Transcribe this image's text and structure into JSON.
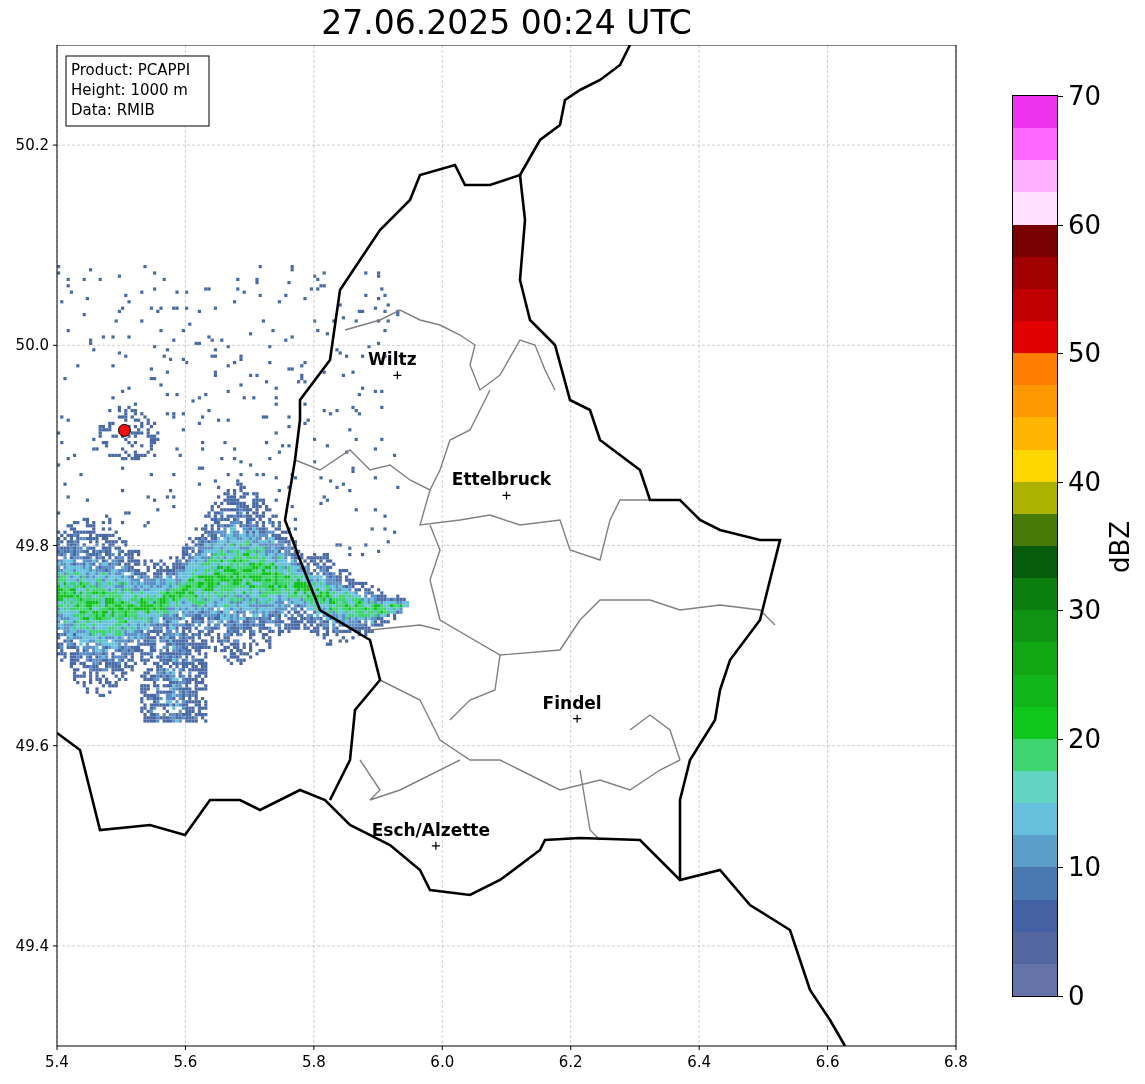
{
  "title": "27.06.2025 00:24 UTC",
  "info_box": [
    "Product: PCAPPI",
    "Height: 1000 m",
    "Data: RMIB"
  ],
  "map": {
    "x_axis_ticks": [
      "5.4",
      "5.6",
      "5.8",
      "6.0",
      "6.2",
      "6.4",
      "6.6",
      "6.8"
    ],
    "y_axis_ticks": [
      "50.2",
      "50.0",
      "49.8",
      "49.6",
      "49.4"
    ],
    "cities": [
      {
        "name": "Wiltz"
      },
      {
        "name": "Ettelbruck"
      },
      {
        "name": "Findel"
      },
      {
        "name": "Esch/Alzette"
      }
    ]
  },
  "colorbar": {
    "label": "dBZ",
    "ticks": [
      "70",
      "60",
      "50",
      "40",
      "30",
      "20",
      "10",
      "0"
    ],
    "levels": [
      {
        "color": "#ee33ee"
      },
      {
        "color": "#ff66ff"
      },
      {
        "color": "#ffb0ff"
      },
      {
        "color": "#ffe0ff"
      },
      {
        "color": "#780000"
      },
      {
        "color": "#a00000"
      },
      {
        "color": "#c00000"
      },
      {
        "color": "#e00000"
      },
      {
        "color": "#ff7d00"
      },
      {
        "color": "#ff9800"
      },
      {
        "color": "#ffb400"
      },
      {
        "color": "#ffd700"
      },
      {
        "color": "#acb200"
      },
      {
        "color": "#487a0a"
      },
      {
        "color": "#075c0c"
      },
      {
        "color": "#0c7e10"
      },
      {
        "color": "#0f9312"
      },
      {
        "color": "#10a614"
      },
      {
        "color": "#10b61a"
      },
      {
        "color": "#10c81b"
      },
      {
        "color": "#3ed46f"
      },
      {
        "color": "#62d4c4"
      },
      {
        "color": "#66bfdd"
      },
      {
        "color": "#5b9ec9"
      },
      {
        "color": "#4a78b0"
      },
      {
        "color": "#4361a3"
      },
      {
        "color": "#5467a0"
      },
      {
        "color": "#6474a8"
      }
    ]
  }
}
